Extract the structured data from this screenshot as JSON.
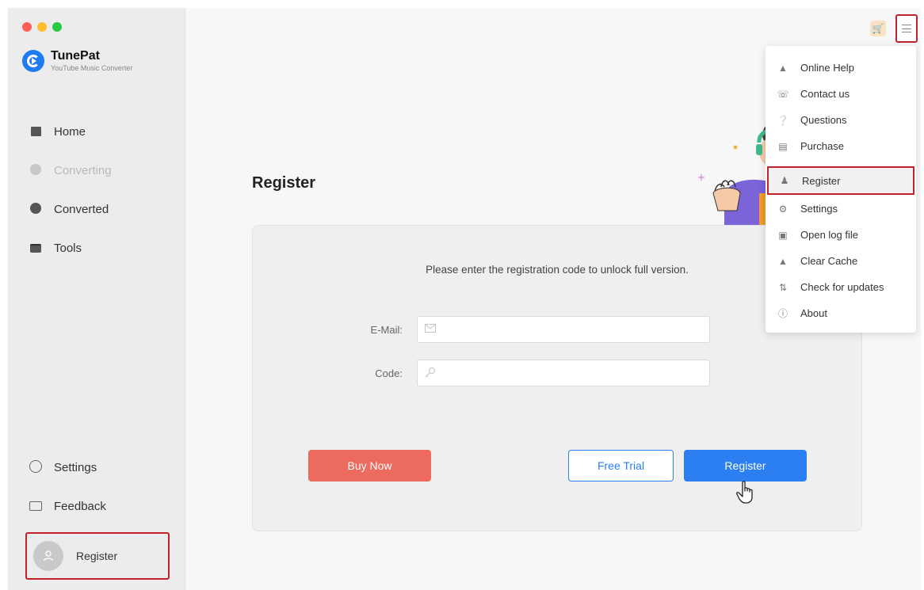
{
  "app": {
    "name": "TunePat",
    "subtitle": "YouTube Music Converter"
  },
  "sidebar": {
    "items": [
      {
        "label": "Home",
        "icon": "home-icon"
      },
      {
        "label": "Converting",
        "icon": "converting-icon",
        "disabled": true
      },
      {
        "label": "Converted",
        "icon": "clock-icon"
      },
      {
        "label": "Tools",
        "icon": "toolbox-icon"
      }
    ],
    "bottom": [
      {
        "label": "Settings",
        "icon": "settings-icon"
      },
      {
        "label": "Feedback",
        "icon": "mail-icon"
      }
    ],
    "register_label": "Register"
  },
  "main": {
    "title": "Register",
    "message": "Please enter the registration code to unlock full version.",
    "email_label": "E-Mail:",
    "code_label": "Code:",
    "email_value": "",
    "code_value": "",
    "buy_label": "Buy Now",
    "trial_label": "Free Trial",
    "register_label": "Register"
  },
  "menu": {
    "items": [
      {
        "label": "Online Help",
        "icon": "graduation-cap-icon"
      },
      {
        "label": "Contact us",
        "icon": "phone-icon"
      },
      {
        "label": "Questions",
        "icon": "question-icon"
      },
      {
        "label": "Purchase",
        "icon": "cart-icon"
      },
      {
        "label": "Register",
        "icon": "user-key-icon",
        "highlighted": true
      },
      {
        "label": "Settings",
        "icon": "gear-icon"
      },
      {
        "label": "Open log file",
        "icon": "file-icon"
      },
      {
        "label": "Clear Cache",
        "icon": "broom-icon"
      },
      {
        "label": "Check for updates",
        "icon": "refresh-icon"
      },
      {
        "label": "About",
        "icon": "info-icon"
      }
    ]
  },
  "colors": {
    "accent": "#2b7ff0",
    "buy": "#ed6a5e",
    "highlight_border": "#c0232c"
  }
}
